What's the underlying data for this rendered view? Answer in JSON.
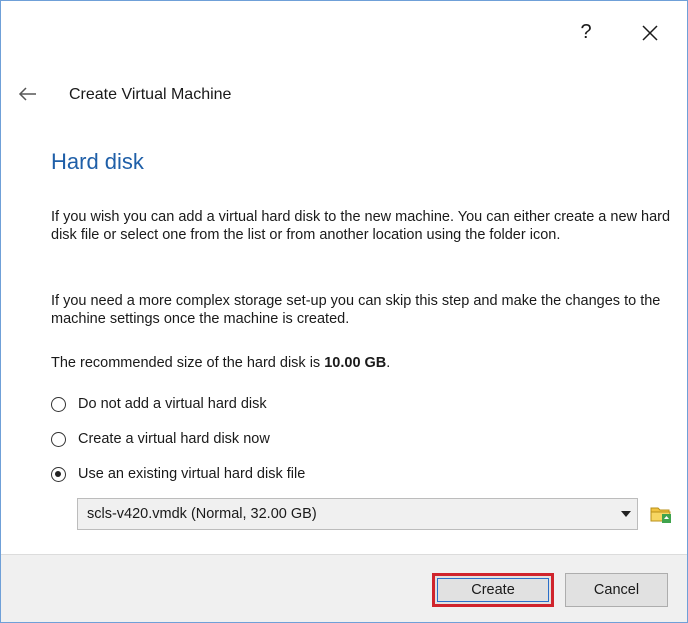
{
  "window": {
    "help_label": "?",
    "wizard_title": "Create Virtual Machine"
  },
  "page": {
    "title": "Hard disk",
    "paragraph1": "If you wish you can add a virtual hard disk to the new machine. You can either create a new hard disk file or select one from the list or from another location using the folder icon.",
    "paragraph2": "If you need a more complex storage set-up you can skip this step and make the changes to the machine settings once the machine is created.",
    "recommended_prefix": "The recommended size of the hard disk is ",
    "recommended_size": "10.00 GB",
    "recommended_suffix": "."
  },
  "options": [
    {
      "label": "Do not add a virtual hard disk",
      "checked": false
    },
    {
      "label": "Create a virtual hard disk now",
      "checked": false
    },
    {
      "label": "Use an existing virtual hard disk file",
      "checked": true
    }
  ],
  "disk_select": {
    "value": "scls-v420.vmdk (Normal, 32.00 GB)"
  },
  "footer": {
    "create_label": "Create",
    "cancel_label": "Cancel"
  },
  "colors": {
    "accent": "#1f5fa8",
    "highlight": "#d0242c",
    "folder": "#f2c340",
    "folder_badge": "#3fa34d"
  },
  "icons": [
    "close-icon",
    "back-arrow-icon",
    "dropdown-arrow-icon",
    "folder-icon"
  ]
}
